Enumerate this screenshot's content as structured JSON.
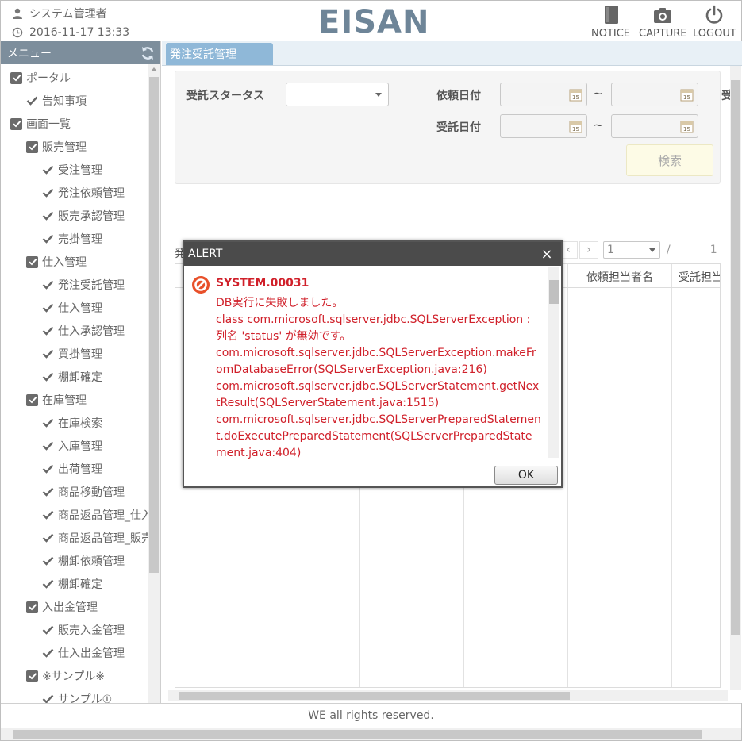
{
  "header": {
    "user_name": "システム管理者",
    "datetime": "2016-11-17 13:33",
    "logo": "EISAN",
    "notice_label": "NOTICE",
    "capture_label": "CAPTURE",
    "logout_label": "LOGOUT"
  },
  "sidebar": {
    "title": "メニュー",
    "items": [
      {
        "label": "ポータル",
        "level": 0,
        "type": "checkbox"
      },
      {
        "label": "告知事項",
        "level": 1,
        "type": "check"
      },
      {
        "label": "画面一覧",
        "level": 0,
        "type": "checkbox"
      },
      {
        "label": "販売管理",
        "level": 1,
        "type": "checkbox"
      },
      {
        "label": "受注管理",
        "level": 2,
        "type": "check"
      },
      {
        "label": "発注依頼管理",
        "level": 2,
        "type": "check"
      },
      {
        "label": "販売承認管理",
        "level": 2,
        "type": "check"
      },
      {
        "label": "売掛管理",
        "level": 2,
        "type": "check"
      },
      {
        "label": "仕入管理",
        "level": 1,
        "type": "checkbox"
      },
      {
        "label": "発注受託管理",
        "level": 2,
        "type": "check"
      },
      {
        "label": "仕入管理",
        "level": 2,
        "type": "check"
      },
      {
        "label": "仕入承認管理",
        "level": 2,
        "type": "check"
      },
      {
        "label": "買掛管理",
        "level": 2,
        "type": "check"
      },
      {
        "label": "棚卸確定",
        "level": 2,
        "type": "check"
      },
      {
        "label": "在庫管理",
        "level": 1,
        "type": "checkbox"
      },
      {
        "label": "在庫検索",
        "level": 2,
        "type": "check"
      },
      {
        "label": "入庫管理",
        "level": 2,
        "type": "check"
      },
      {
        "label": "出荷管理",
        "level": 2,
        "type": "check"
      },
      {
        "label": "商品移動管理",
        "level": 2,
        "type": "check"
      },
      {
        "label": "商品返品管理_仕入",
        "level": 2,
        "type": "check"
      },
      {
        "label": "商品返品管理_販売",
        "level": 2,
        "type": "check"
      },
      {
        "label": "棚卸依頼管理",
        "level": 2,
        "type": "check"
      },
      {
        "label": "棚卸確定",
        "level": 2,
        "type": "check"
      },
      {
        "label": "入出金管理",
        "level": 1,
        "type": "checkbox"
      },
      {
        "label": "販売入金管理",
        "level": 2,
        "type": "check"
      },
      {
        "label": "仕入出金管理",
        "level": 2,
        "type": "check"
      },
      {
        "label": "※サンプル※",
        "level": 1,
        "type": "checkbox"
      },
      {
        "label": "サンプル①",
        "level": 2,
        "type": "check"
      }
    ]
  },
  "main": {
    "tab_label": "発注受託管理",
    "search": {
      "status_label": "受託スタータス",
      "status_value": "",
      "request_date_label": "依頼日付",
      "accept_date_label": "受託日付",
      "tilde": "~",
      "cut_label": "受",
      "search_button": "検索"
    },
    "grid": {
      "prefix_text": "発",
      "page_value": "1",
      "page_separator": "/",
      "page_total": "1",
      "columns": [
        "依頼担当者名",
        "受託担当"
      ]
    }
  },
  "footer": {
    "copyright": "WE all rights reserved."
  },
  "dialog": {
    "title": "ALERT",
    "close": "×",
    "code": "SYSTEM.00031",
    "lines": [
      "DB実行に失敗しました。",
      "class com.microsoft.sqlserver.jdbc.SQLServerException : 列名 'status' が無効です。",
      "com.microsoft.sqlserver.jdbc.SQLServerException.makeFromDatabaseError(SQLServerException.java:216)",
      "com.microsoft.sqlserver.jdbc.SQLServerStatement.getNextResult(SQLServerStatement.java:1515)",
      "com.microsoft.sqlserver.jdbc.SQLServerPreparedStatement.doExecutePreparedStatement(SQLServerPreparedStatement.java:404)"
    ],
    "ok_label": "OK"
  },
  "colors": {
    "logo": "#6e8598",
    "menu_header": "#7d8e9c",
    "tab_active": "#8fb8d8",
    "dialog_title": "#4b4b4b",
    "error_text": "#d0202a",
    "error_icon": "#e8502a"
  },
  "icons": {
    "user": "user-icon",
    "clock": "clock-icon",
    "notice": "book-icon",
    "capture": "camera-icon",
    "logout": "power-icon",
    "refresh": "refresh-icon",
    "calendar": "calendar-icon",
    "error": "error-icon"
  }
}
